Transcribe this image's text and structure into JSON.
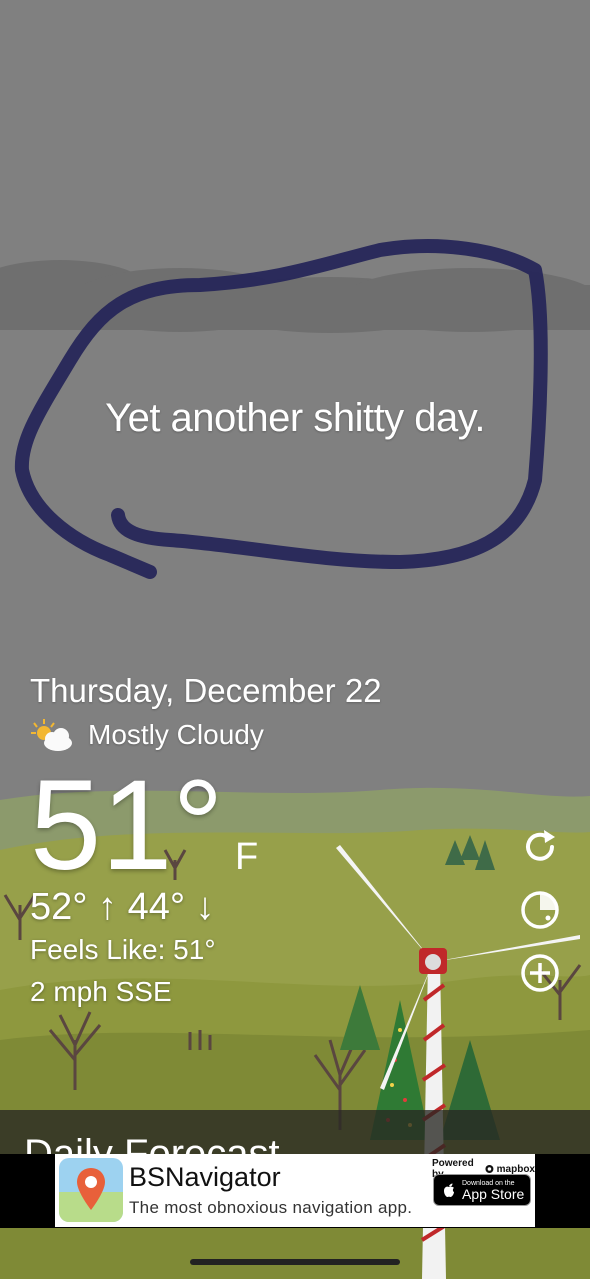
{
  "tagline": "Yet another shitty day.",
  "date": "Thursday, December 22",
  "condition": {
    "text": "Mostly Cloudy",
    "icon": "partly-cloudy-icon"
  },
  "temperature": {
    "current": "51°",
    "unit": "F",
    "hilo": "52° ↑  44° ↓"
  },
  "feels_like": "Feels Like: 51°",
  "wind": "2 mph SSE",
  "side_buttons": [
    "refresh-icon",
    "radar-icon",
    "add-location-icon"
  ],
  "forecast_header": "Daily Forecast",
  "ad": {
    "title": "BSNavigator",
    "subtitle": "The most obnoxious navigation app.",
    "powered_by": "Powered by",
    "powered_brand": "mapbox",
    "store_small": "Download on the",
    "store_big": "App Store"
  },
  "colors": {
    "sky": "#808080",
    "marker": "#2a2a5a",
    "hills": "#8a9a3e",
    "pole_red": "#c0282a"
  }
}
